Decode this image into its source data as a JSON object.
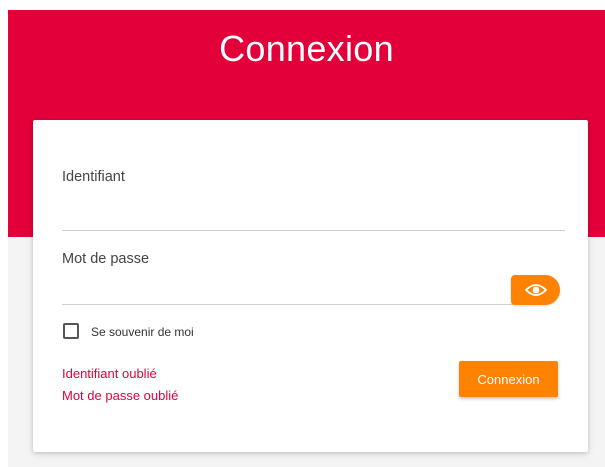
{
  "header": {
    "title": "Connexion"
  },
  "form": {
    "username_label": "Identifiant",
    "username_value": "",
    "password_label": "Mot de passe",
    "password_value": "",
    "show_password_icon": "eye-icon",
    "remember_me_label": "Se souvenir de moi",
    "remember_me_checked": false,
    "forgot_username_link": "Identifiant oublié",
    "forgot_password_link": "Mot de passe oublié",
    "submit_label": "Connexion"
  },
  "colors": {
    "brand_red": "#e3003a",
    "accent_orange": "#ff8200",
    "page_gray": "#f4f4f4"
  }
}
